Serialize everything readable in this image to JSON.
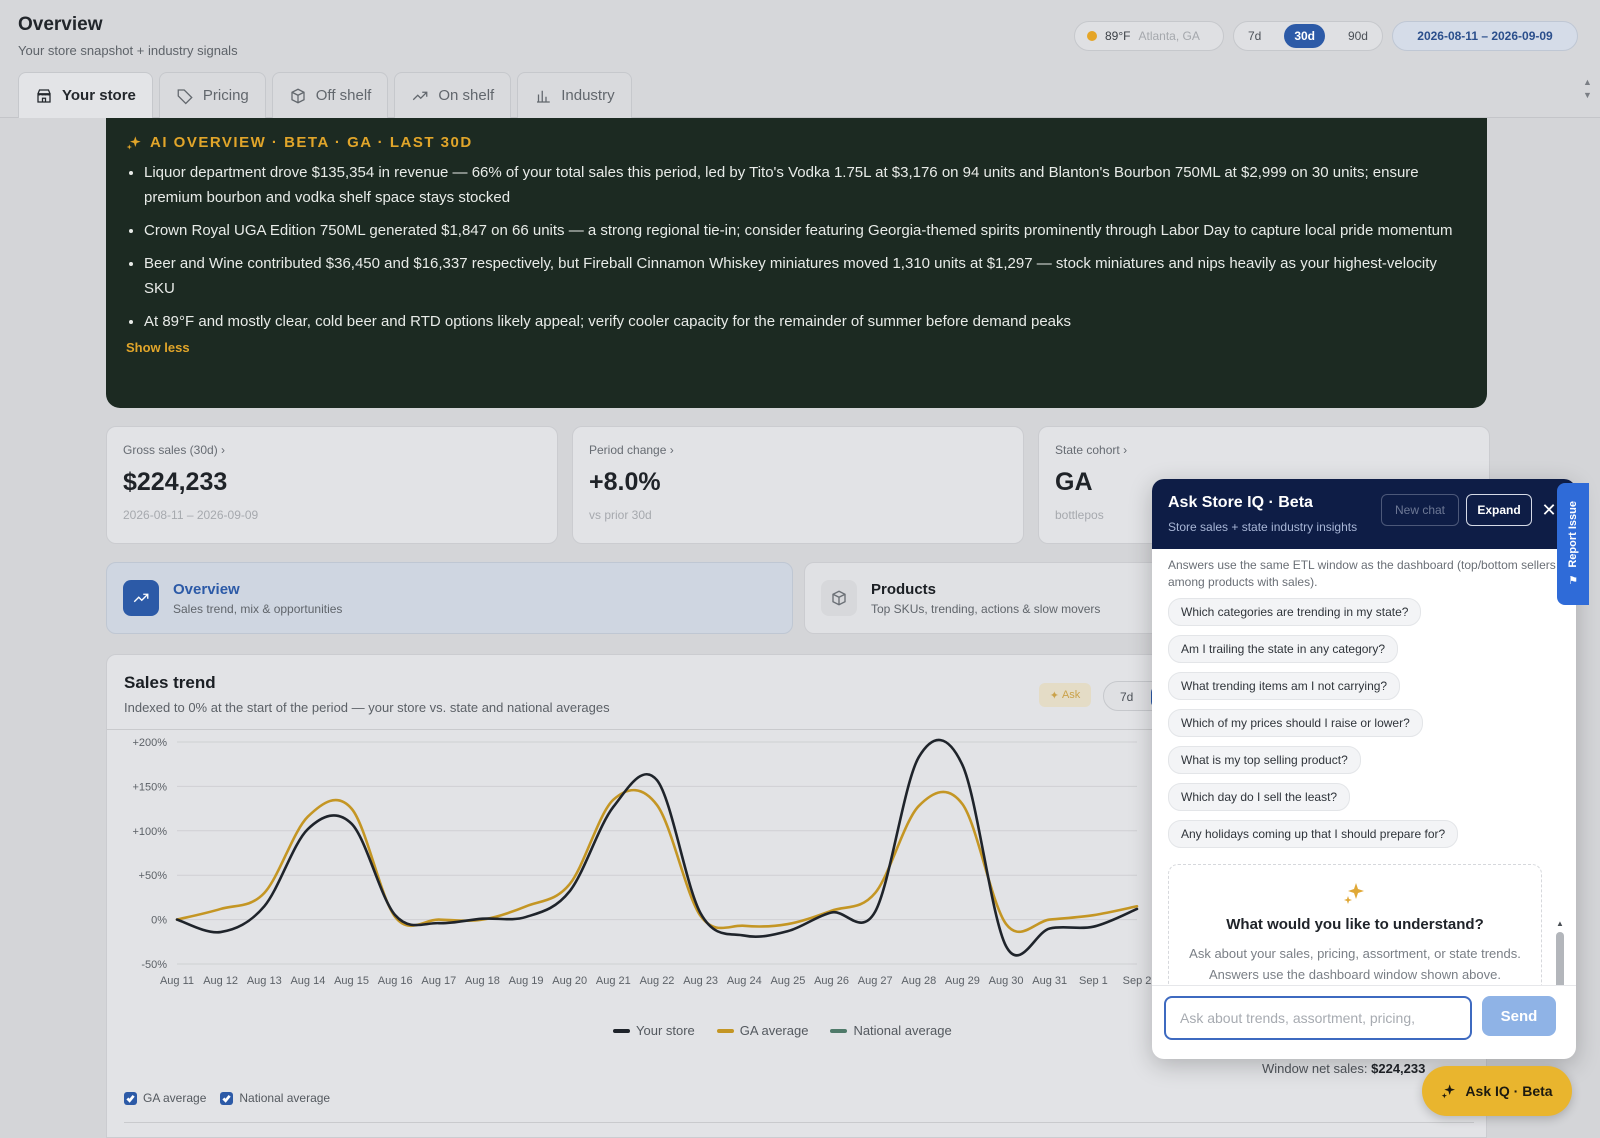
{
  "header": {
    "title": "Overview",
    "subtitle": "Your store snapshot + industry signals",
    "weather": {
      "temp": "89°F",
      "location": "Atlanta, GA"
    },
    "ranges": [
      "7d",
      "30d",
      "90d"
    ],
    "active_range": "30d",
    "date_range": "2026-08-11 – 2026-09-09"
  },
  "tabs": [
    {
      "label": "Your store",
      "icon": "store-icon",
      "active": true
    },
    {
      "label": "Pricing",
      "icon": "tag-icon"
    },
    {
      "label": "Off shelf",
      "icon": "box-icon"
    },
    {
      "label": "On shelf",
      "icon": "trend-up-icon"
    },
    {
      "label": "Industry",
      "icon": "bar-chart-icon"
    }
  ],
  "ai_overview": {
    "title": "AI OVERVIEW · BETA · GA · LAST 30D",
    "bullets": [
      "Liquor department drove $135,354 in revenue — 66% of your total sales this period, led by Tito's Vodka 1.75L at $3,176 on 94 units and Blanton's Bourbon 750ML at $2,999 on 30 units; ensure premium bourbon and vodka shelf space stays stocked",
      "Crown Royal UGA Edition 750ML generated $1,847 on 66 units — a strong regional tie-in; consider featuring Georgia-themed spirits prominently through Labor Day to capture local pride momentum",
      "Beer and Wine contributed $36,450 and $16,337 respectively, but Fireball Cinnamon Whiskey miniatures moved 1,310 units at $1,297 — stock miniatures and nips heavily as your highest-velocity SKU",
      "At 89°F and mostly clear, cold beer and RTD options likely appeal; verify cooler capacity for the remainder of summer before demand peaks"
    ],
    "toggle_label": "Show less"
  },
  "kpis": [
    {
      "label": "Gross sales (30d)",
      "value": "$224,233",
      "foot": "2026-08-11 – 2026-09-09"
    },
    {
      "label": "Period change",
      "value": "+8.0%",
      "foot": "vs prior 30d"
    },
    {
      "label": "State cohort",
      "value": "GA",
      "foot": "bottlepos"
    }
  ],
  "sections": [
    {
      "title": "Overview",
      "subtitle": "Sales trend, mix & opportunities",
      "active": true
    },
    {
      "title": "Products",
      "subtitle": "Top SKUs, trending, actions & slow movers"
    }
  ],
  "sales_trend": {
    "title": "Sales trend",
    "subtitle": "Indexed to 0% at the start of the period — your store vs. state and national averages",
    "ask_label": "Ask",
    "range_label": "7d",
    "window_net_label": "Window net sales:",
    "window_net_value": "$224,233",
    "toggles": [
      {
        "label": "GA average",
        "checked": true
      },
      {
        "label": "National average",
        "checked": true
      }
    ]
  },
  "chart_data": {
    "type": "line",
    "title": "Sales trend",
    "ylabel": "",
    "xlabel": "",
    "x": [
      "Aug 11",
      "Aug 12",
      "Aug 13",
      "Aug 14",
      "Aug 15",
      "Aug 16",
      "Aug 17",
      "Aug 18",
      "Aug 19",
      "Aug 20",
      "Aug 21",
      "Aug 22",
      "Aug 23",
      "Aug 24",
      "Aug 25",
      "Aug 26",
      "Aug 27",
      "Aug 28",
      "Aug 29",
      "Aug 30",
      "Aug 31",
      "Sep 1",
      "Sep 2"
    ],
    "yticks": [
      "+200%",
      "+150%",
      "+100%",
      "+50%",
      "0%",
      "-50%"
    ],
    "ylim": [
      -50,
      200
    ],
    "series": [
      {
        "name": "Your store",
        "color": "#1f242b",
        "values": [
          0,
          -14,
          15,
          102,
          108,
          5,
          -4,
          1,
          3,
          32,
          127,
          157,
          7,
          -18,
          -13,
          8,
          9,
          183,
          174,
          -30,
          -10,
          -8,
          12
        ]
      },
      {
        "name": "GA average",
        "color": "#c49624",
        "values": [
          0,
          12,
          30,
          116,
          125,
          3,
          0,
          0,
          15,
          40,
          135,
          129,
          4,
          -7,
          -5,
          10,
          30,
          128,
          130,
          -5,
          0,
          5,
          15
        ]
      },
      {
        "name": "National average",
        "color": "#4f7a6a",
        "values": []
      }
    ],
    "grid": true,
    "legend": "bottom"
  },
  "assistant": {
    "title": "Ask Store IQ · Beta",
    "subtitle": "Store sales + state industry insights",
    "new_chat_label": "New chat",
    "expand_label": "Expand",
    "note": "Answers use the same ETL window as the dashboard (top/bottom sellers among products with sales).",
    "suggestions": [
      "Which categories are trending in my state?",
      "Am I trailing the state in any category?",
      "What trending items am I not carrying?",
      "Which of my prices should I raise or lower?",
      "What is my top selling product?",
      "Which day do I sell the least?",
      "Any holidays coming up that I should prepare for?"
    ],
    "empty_title": "What would you like to understand?",
    "empty_text": "Ask about your sales, pricing, assortment, or state trends. Answers use the dashboard window shown above.",
    "input_placeholder": "Ask about trends, assortment, pricing,",
    "send_label": "Send"
  },
  "report_issue_label": "Report Issue",
  "fab_label": "Ask IQ · Beta"
}
